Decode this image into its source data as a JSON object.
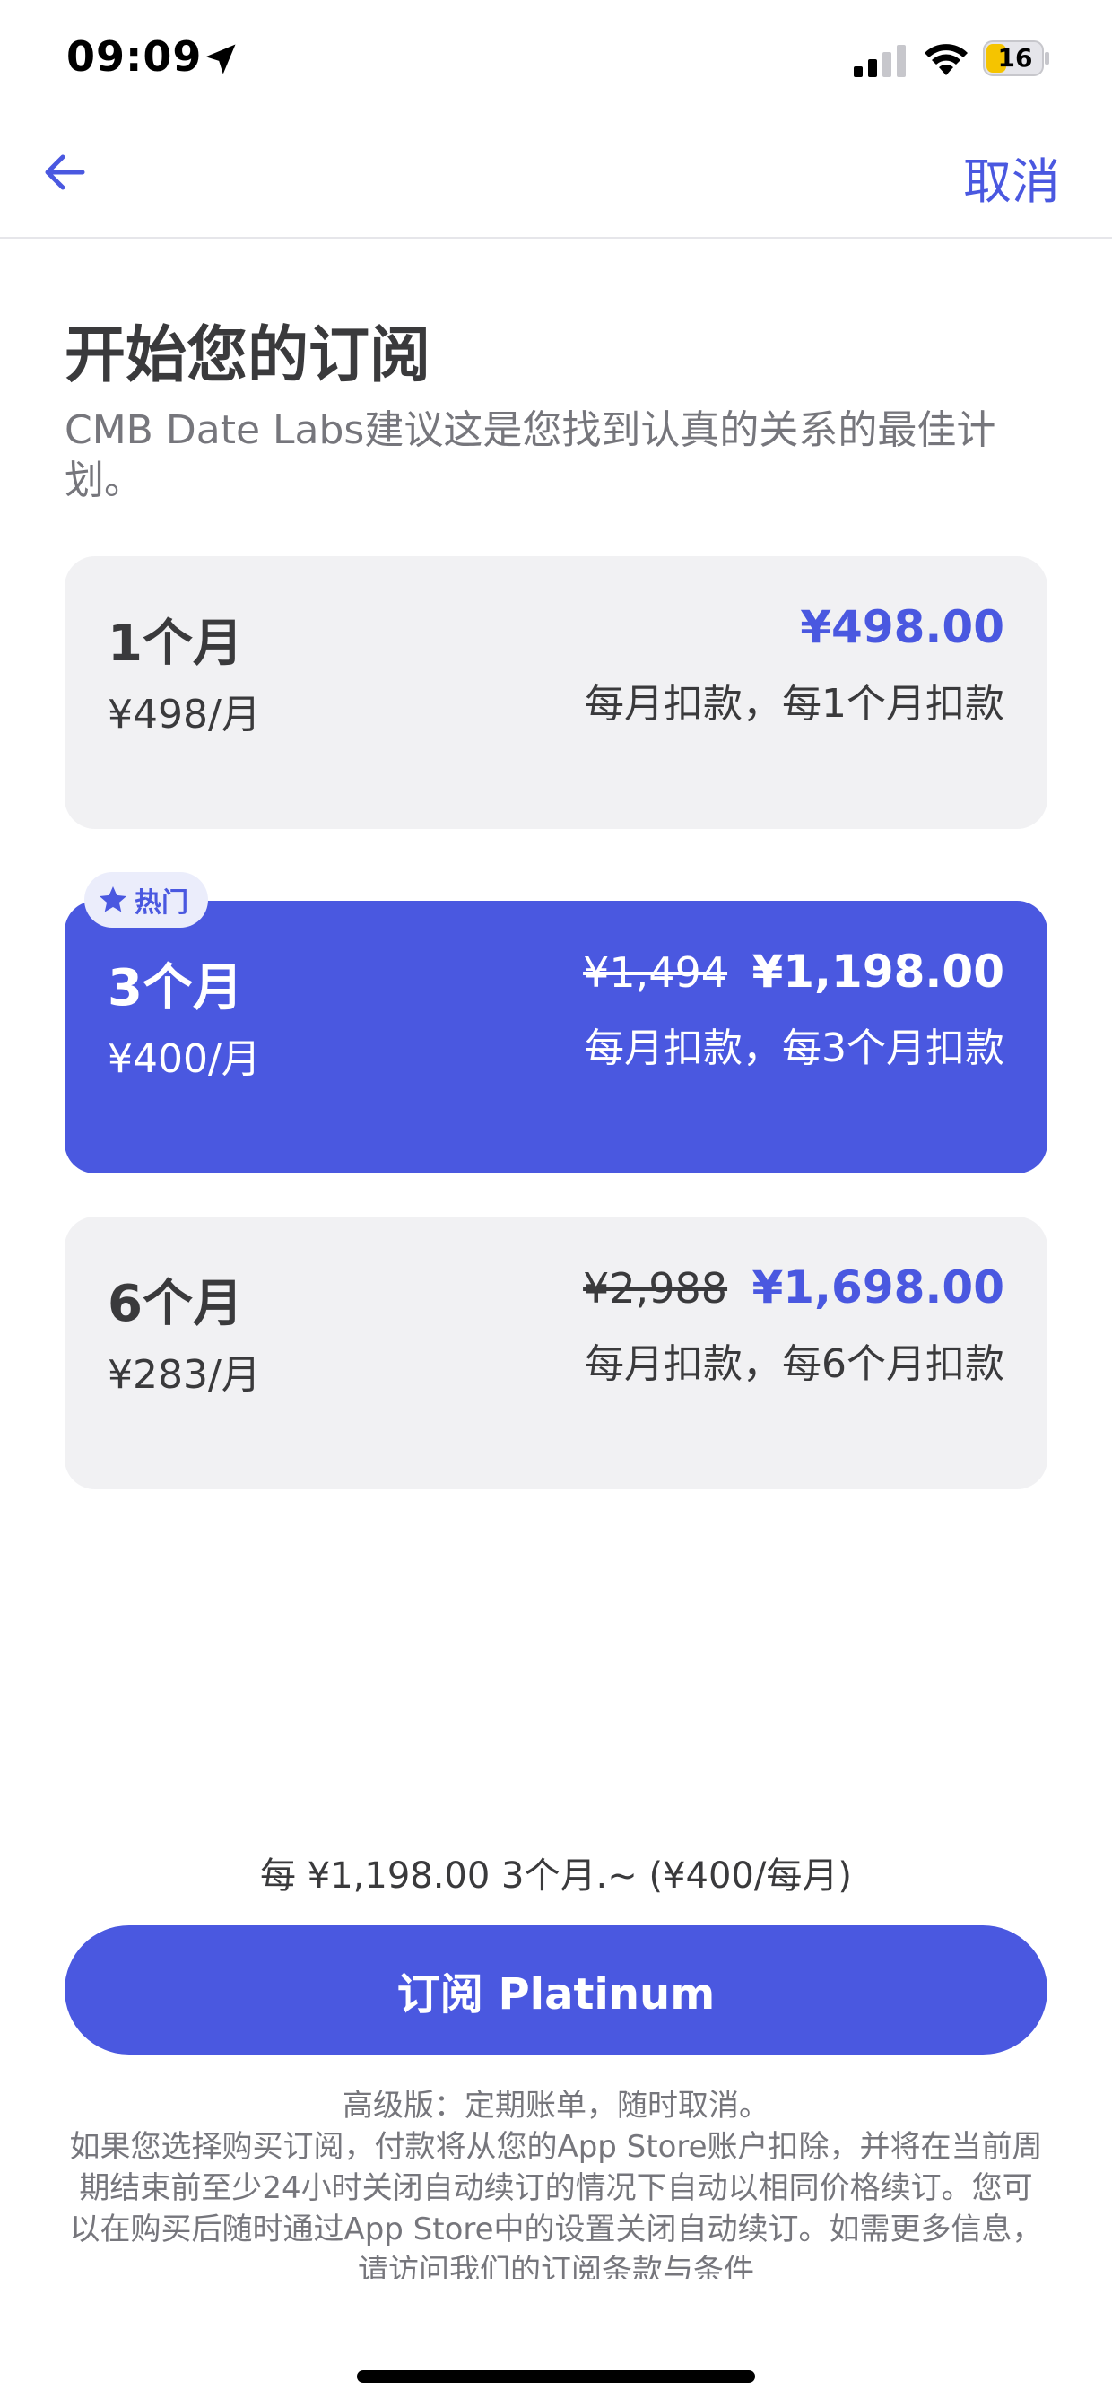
{
  "status_bar": {
    "time": "09:09",
    "battery": "16"
  },
  "nav": {
    "cancel_label": "取消",
    "back_icon": "arrow-left-icon"
  },
  "header": {
    "title": "开始您的订阅",
    "subtitle": "CMB Date Labs建议这是您找到认真的关系的最佳计划。"
  },
  "plans": [
    {
      "name": "1个月",
      "per_month": "¥498/月",
      "original_price": "",
      "price": "¥498.00",
      "billing": "每月扣款，每1个月扣款",
      "selected": false
    },
    {
      "name": "3个月",
      "per_month": "¥400/月",
      "original_price": "¥1,494",
      "price": "¥1,198.00",
      "billing": "每月扣款，每3个月扣款",
      "selected": true,
      "badge": "热门"
    },
    {
      "name": "6个月",
      "per_month": "¥283/月",
      "original_price": "¥2,988",
      "price": "¥1,698.00",
      "billing": "每月扣款，每6个月扣款",
      "selected": false
    }
  ],
  "summary": "每 ¥1,198.00 3个月.~ (¥400/每月)",
  "cta": {
    "label": "订阅 Platinum"
  },
  "legal": {
    "heading": "高级版：定期账单，随时取消。",
    "text": "如果您选择购买订阅，付款将从您的App Store账户扣除，并将在当前周期结束前至少24小时关闭自动续订的情况下自动以相同价格续订。您可以在购买后随时通过App Store中的设置关闭自动续订。如需更多信息，请访问我们的订阅条款与条件"
  },
  "colors": {
    "accent": "#4a58e0",
    "card_bg": "#f1f1f3",
    "badge_bg": "#ebedfb",
    "text": "#3a3a3c",
    "muted": "#76767c"
  }
}
